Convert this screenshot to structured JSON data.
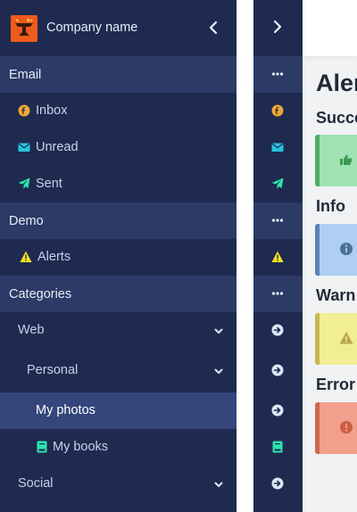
{
  "brand": {
    "name": "Company name"
  },
  "sidebar": {
    "sections": [
      {
        "label": "Email"
      },
      {
        "label": "Demo"
      },
      {
        "label": "Categories"
      }
    ],
    "items": [
      {
        "label": "Inbox",
        "icon": "facebook-icon",
        "color": "#f0a830"
      },
      {
        "label": "Unread",
        "icon": "envelope-icon",
        "color": "#26c3e0"
      },
      {
        "label": "Sent",
        "icon": "paper-plane-icon",
        "color": "#2ee3b0"
      },
      {
        "label": "Alerts",
        "icon": "warning-icon",
        "color": "#f7e01e"
      },
      {
        "label": "Web",
        "icon": "chevron-down-icon"
      },
      {
        "label": "Personal",
        "icon": "chevron-down-icon"
      },
      {
        "label": "My photos"
      },
      {
        "label": "My books",
        "icon": "book-icon",
        "color": "#2ee3b0"
      },
      {
        "label": "Social",
        "icon": "chevron-down-icon"
      }
    ]
  },
  "content": {
    "title": "Aler",
    "sections": [
      {
        "label": "Succe"
      },
      {
        "label": "Info"
      },
      {
        "label": "Warn"
      },
      {
        "label": "Error"
      }
    ]
  }
}
